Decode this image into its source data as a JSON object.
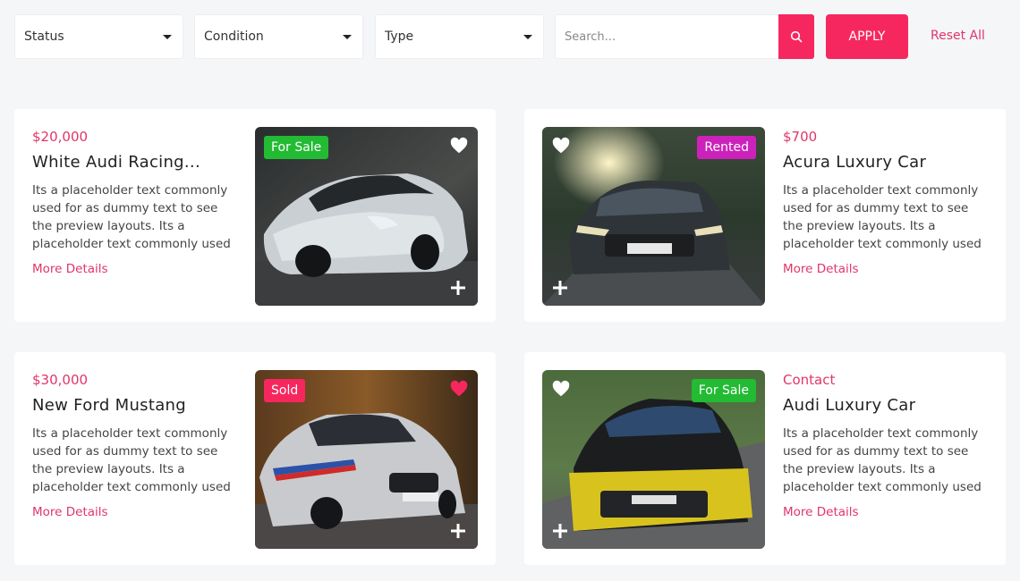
{
  "filters": {
    "status": "Status",
    "condition": "Condition",
    "type": "Type",
    "search_placeholder": "Search...",
    "apply": "APPLY",
    "reset": "Reset All"
  },
  "colors": {
    "accent": "#f6275f",
    "for_sale": "#22bb33",
    "rented": "#cc22bb",
    "sold": "#f6275f"
  },
  "listings": [
    {
      "price": "$20,000",
      "title": "White Audi Racing...",
      "description": "Its a placeholder text commonly used for as dummy text to see the preview layouts. Its a placeholder text commonly used for as dummy text to see the preview layouts....",
      "more": "More Details",
      "badge": "For Sale",
      "favorited": false
    },
    {
      "price": "$700",
      "title": "Acura Luxury Car",
      "description": "Its a placeholder text commonly used for as dummy text to see the preview layouts. Its a placeholder text commonly used for as dummy text to see the preview layouts....",
      "more": "More Details",
      "badge": "Rented",
      "favorited": false
    },
    {
      "price": "$30,000",
      "title": "New Ford Mustang",
      "description": "Its a placeholder text commonly used for as dummy text to see the preview layouts. Its a placeholder text commonly used for as dummy text to see the preview layouts....",
      "more": "More Details",
      "badge": "Sold",
      "favorited": true
    },
    {
      "price": "Contact",
      "title": "Audi Luxury Car",
      "description": "Its a placeholder text commonly used for as dummy text to see the preview layouts. Its a placeholder text commonly used for as dummy text to see the preview layouts....",
      "more": "More Details",
      "badge": "For Sale",
      "favorited": false
    }
  ]
}
